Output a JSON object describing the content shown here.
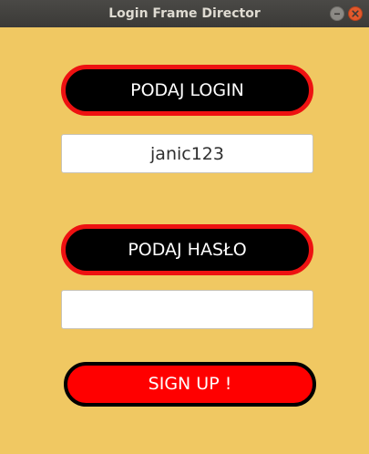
{
  "window": {
    "title": "Login Frame Director",
    "minimize_icon": "minimize-icon",
    "close_icon": "close-icon"
  },
  "form": {
    "login_label": "PODAJ LOGIN",
    "login_value": "janic123",
    "password_label": "PODAJ HASŁO",
    "password_value": "",
    "signup_label": "SIGN UP !"
  },
  "colors": {
    "background": "#f0c862",
    "label_fill": "#000000",
    "label_border": "#ee1111",
    "signup_fill": "#ff0000",
    "signup_border": "#000000",
    "label_text": "#ffffff"
  }
}
